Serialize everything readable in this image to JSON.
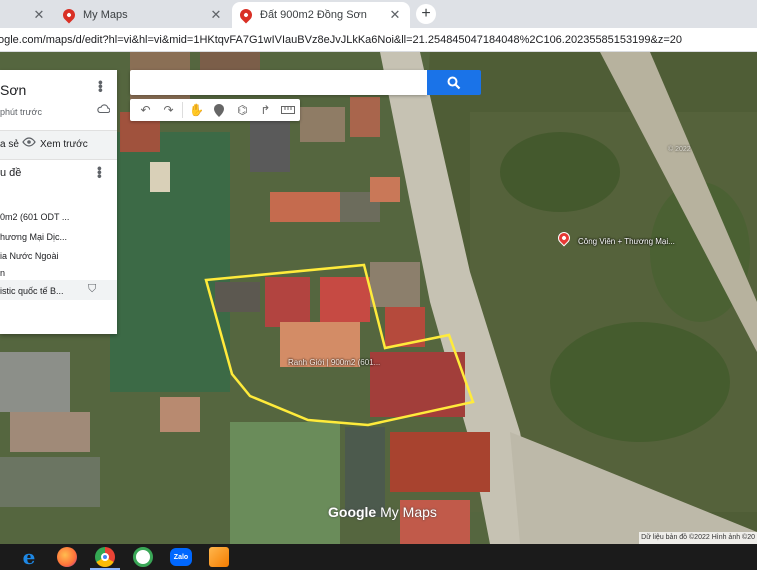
{
  "browser": {
    "tabs": [
      {
        "title": "",
        "active": false
      },
      {
        "title": "My Maps",
        "active": false
      },
      {
        "title": "Đất 900m2 Đồng Sơn",
        "active": true
      }
    ],
    "url": "ogle.com/maps/d/edit?hl=vi&hl=vi&mid=1HKtqvFA7G1wIVIauBVz8eJvJLkKa6Noi&ll=21.254845047184048%2C106.20235585153199&z=20"
  },
  "map_ui": {
    "search_placeholder": "",
    "panel": {
      "title": "Sơn",
      "subtitle": "phút trước",
      "share_label": "a sẻ",
      "preview_label": "Xem trước",
      "layer_title": "u đề",
      "items": [
        "0m2 (601 ODT ...",
        "hương Mại Dịc...",
        "ia Nước Ngoài",
        "n",
        "istic quốc tế B..."
      ]
    },
    "place_label_1": "Công Viên + Thương Mại...",
    "place_label_2": "Ranh Giới | 900m2 (601...",
    "watermark": "© 2022",
    "logo_google": "Google",
    "logo_mymaps": "My Maps",
    "attribution": "Dữ liệu bản đồ ©2022 Hình ảnh ©20"
  },
  "taskbar": {
    "apps": [
      {
        "name": "internet-explorer",
        "color": "#1e88e5"
      },
      {
        "name": "firefox",
        "color": "#ff7139"
      },
      {
        "name": "chrome",
        "color": "#4caf50"
      },
      {
        "name": "coccoc",
        "color": "#3aa757"
      },
      {
        "name": "zalo",
        "color": "#0068ff",
        "label": "Zalo"
      },
      {
        "name": "app-orange",
        "color": "#f57c00"
      }
    ]
  }
}
